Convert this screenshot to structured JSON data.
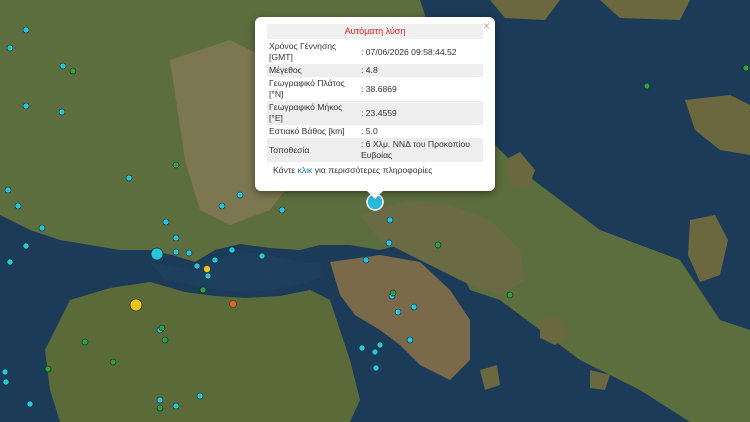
{
  "popup": {
    "title": "Αυτόματη λύση",
    "close_symbol": "×",
    "rows": [
      {
        "label": "Χρόνος Γέννησης [GMT]",
        "value": ": 07/06/2026 09:58:44.52"
      },
      {
        "label": "Μέγεθος",
        "value": ": 4.8"
      },
      {
        "label": "Γεωγραφικό Πλάτος [°N]",
        "value": ": 38.6869"
      },
      {
        "label": "Γεωγραφικό Μήκος [°E]",
        "value": ": 23.4559"
      },
      {
        "label": "Εστιακό Βάθος [km]",
        "value": ": 5.0"
      },
      {
        "label": "Τοποθεσία",
        "value": ": 6 Χλμ. ΝΝΔ του Προκοπίου Ευβοίας"
      }
    ],
    "more_prefix": "Κάντε ",
    "more_link": "κλικ",
    "more_suffix": " για περισσότερες πληροφορίες"
  },
  "map": {
    "colors": {
      "sea": "#1c3b58",
      "land": "#5a6b3c",
      "mountain": "#7a6a4e",
      "highlight_event": "#2bb8d9"
    },
    "event_colors": {
      "cyan": "#26c6da",
      "green": "#2e9e4b",
      "yellow": "#e8c51a",
      "orange": "#e8621a"
    }
  }
}
